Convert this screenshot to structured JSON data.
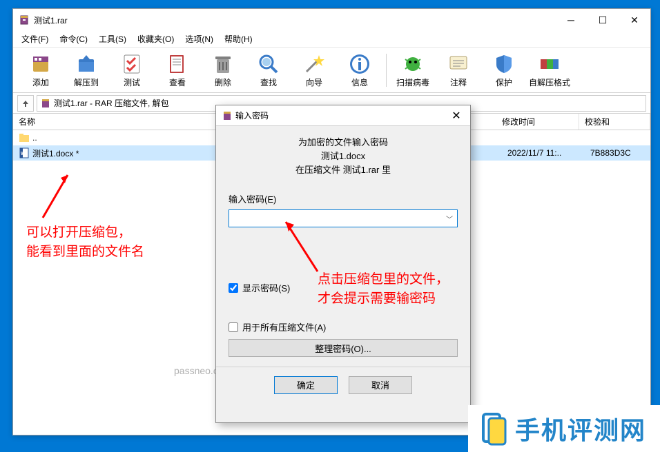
{
  "window": {
    "title": "测试1.rar"
  },
  "menu": {
    "items": [
      "文件(F)",
      "命令(C)",
      "工具(S)",
      "收藏夹(O)",
      "选项(N)",
      "帮助(H)"
    ]
  },
  "toolbar": {
    "add": "添加",
    "extract": "解压到",
    "test": "测试",
    "view": "查看",
    "delete": "删除",
    "find": "查找",
    "wizard": "向导",
    "info": "信息",
    "virus": "扫描病毒",
    "comment": "注释",
    "protect": "保护",
    "sfx": "自解压格式"
  },
  "pathbar": {
    "text": "测试1.rar - RAR 压缩文件, 解包"
  },
  "columns": {
    "name": "名称",
    "modified": "修改时间",
    "crc": "校验和"
  },
  "rows": [
    {
      "name": "..",
      "mod": "",
      "crc": ""
    },
    {
      "name": "测试1.docx *",
      "mod": "2022/11/7 11:..",
      "crc": "7B883D3C"
    }
  ],
  "dialog": {
    "title": "输入密码",
    "msg1": "为加密的文件输入密码",
    "msg2": "测试1.docx",
    "msg3": "在压缩文件 测试1.rar 里",
    "pwLabel": "输入密码(E)",
    "showPw": "显示密码(S)",
    "allArchives": "用于所有压缩文件(A)",
    "organize": "整理密码(O)...",
    "ok": "确定",
    "cancel": "取消"
  },
  "annotations": {
    "left1": "可以打开压缩包，",
    "left2": "能看到里面的文件名",
    "right1": "点击压缩包里的文件，",
    "right2": "才会提示需要输密码"
  },
  "watermark": "passneo.cn",
  "logo": "手机评测网"
}
